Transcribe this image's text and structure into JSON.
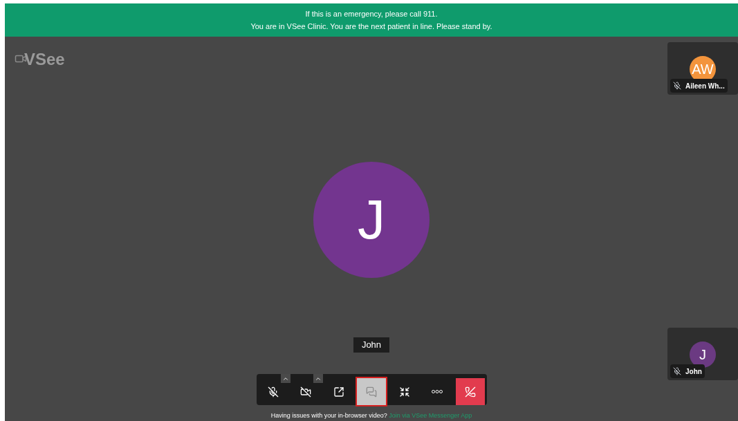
{
  "banner": {
    "lines": [
      "If this is an emergency, please call 911.",
      "You are in VSee Clinic. You are the next patient in line. Please stand by."
    ]
  },
  "logo": {
    "text": "VSee"
  },
  "main_participant": {
    "initial": "J",
    "color": "#73358f",
    "name": "John"
  },
  "tiles": [
    {
      "initials": "AW",
      "color": "#f3943c",
      "name": "Aileen Wh...",
      "muted": true
    },
    {
      "initials": "J",
      "color": "#6b3a82",
      "name": "John",
      "muted": true
    }
  ],
  "toolbar": [
    {
      "kind": "mic-off",
      "has_menu": true,
      "selected": false
    },
    {
      "kind": "camera-off",
      "has_menu": true,
      "selected": false
    },
    {
      "kind": "share",
      "has_menu": false,
      "selected": false
    },
    {
      "kind": "chat",
      "has_menu": false,
      "selected": true
    },
    {
      "kind": "collapse",
      "has_menu": false,
      "selected": false
    },
    {
      "kind": "more",
      "has_menu": false,
      "selected": false
    },
    {
      "kind": "hang-up",
      "has_menu": false,
      "selected": false
    }
  ],
  "help": {
    "text": "Having issues with your in-browser video?",
    "link": "Join via VSee Messenger App"
  }
}
